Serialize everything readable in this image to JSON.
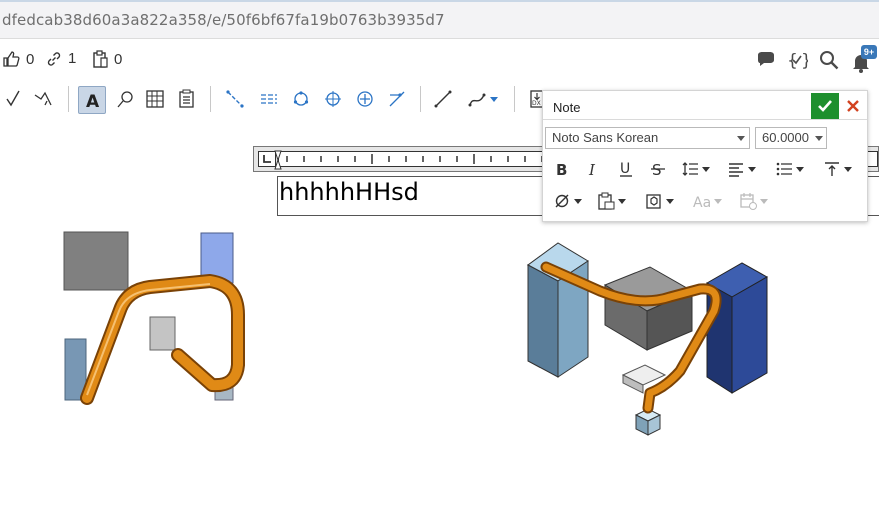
{
  "url": "dfedcab38d60a3a822a358/e/50f6bf67fa19b0763b3935d7",
  "social": {
    "likes": "0",
    "links": "1",
    "copies": "0",
    "notifications": "9+"
  },
  "note_panel": {
    "title": "Note",
    "font": "Noto Sans Korean",
    "size": "60.0000"
  },
  "note_text": "hhhhhHHsd",
  "colors": {
    "pipe": "#e08a16",
    "accent": "#3a78b8",
    "ok": "#1e8f2e",
    "cancel": "#d2421f"
  }
}
